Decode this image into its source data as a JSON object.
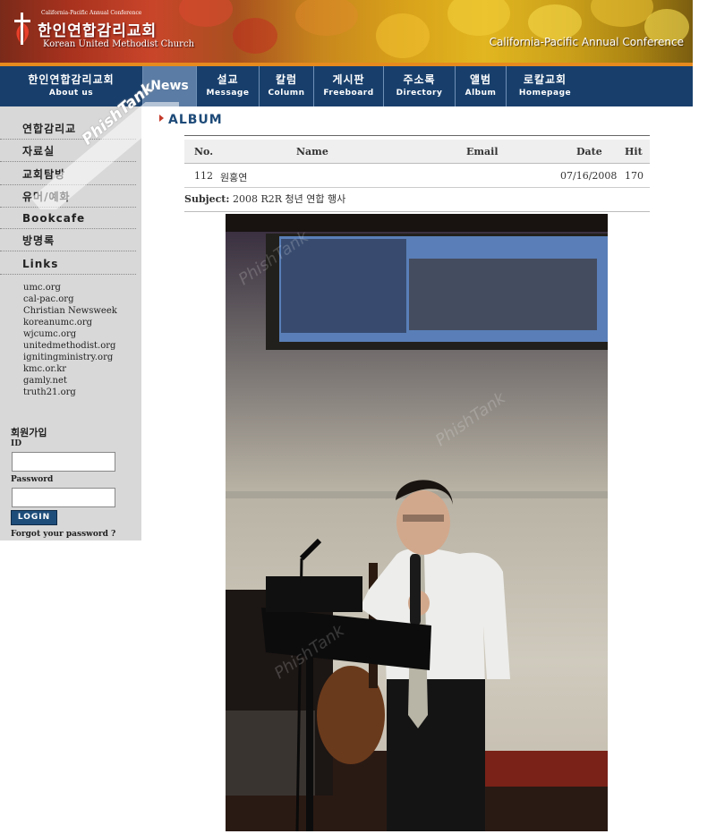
{
  "banner": {
    "org_tiny": "California-Pacific Annual Conference",
    "org_title": "한인연합감리교회",
    "org_subtitle": "Korean United Methodist Church",
    "conference": "California-Pacific Annual Conference",
    "colors": {
      "orange_bar": "#e68a1e",
      "nav_bg": "#183f6c"
    }
  },
  "nav": {
    "items": [
      {
        "ko": "한인연합감리교회",
        "en": "About us"
      },
      {
        "en": "News"
      },
      {
        "ko": "설교",
        "en": "Message"
      },
      {
        "ko": "칼럼",
        "en": "Column"
      },
      {
        "ko": "게시판",
        "en": "Freeboard"
      },
      {
        "ko": "주소록",
        "en": "Directory"
      },
      {
        "ko": "앨범",
        "en": "Album"
      },
      {
        "ko": "로칼교회",
        "en": "Homepage"
      }
    ]
  },
  "sidebar": {
    "watermark": "PhishTank",
    "menu": [
      "연합감리교",
      "자료실",
      "교회탐방",
      "유머/예화",
      "Bookcafe",
      "방명록",
      "Links"
    ],
    "links": [
      "umc.org",
      "cal-pac.org",
      "Christian Newsweek",
      "koreanumc.org",
      "wjcumc.org",
      "unitedmethodist.org",
      "ignitingministry.org",
      "kmc.or.kr",
      "gamly.net",
      "truth21.org"
    ],
    "login": {
      "title": "회원가입",
      "id_label": "ID",
      "password_label": "Password",
      "button": "LOGIN",
      "forgot": "Forgot your password ?"
    }
  },
  "main": {
    "heading": "ALBUM",
    "table": {
      "headers": {
        "no": "No.",
        "name": "Name",
        "email": "Email",
        "date": "Date",
        "hit": "Hit"
      },
      "row": {
        "no": "112",
        "name": "원홍연",
        "email": "",
        "date": "07/16/2008",
        "hit": "170"
      }
    },
    "subject_label": "Subject:",
    "subject": "2008 R2R 청년 연합 행사"
  }
}
